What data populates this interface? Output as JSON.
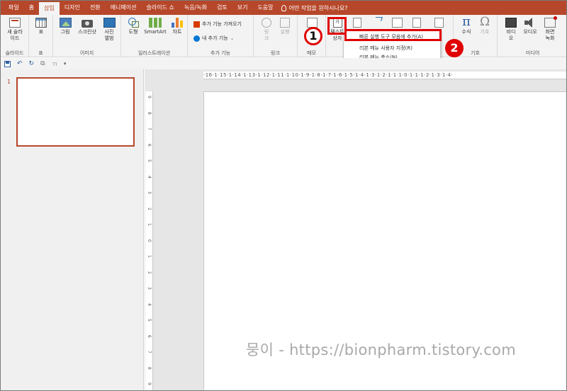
{
  "menu": {
    "tabs": [
      "파일",
      "홈",
      "삽입",
      "디자인",
      "전환",
      "애니메이션",
      "슬라이드 쇼",
      "녹음/녹화",
      "검토",
      "보기",
      "도움말"
    ],
    "active_tab": "삽입",
    "tell_me": "어떤 작업을 원하시나요?"
  },
  "ribbon": {
    "new_slide": "새 슬라이드",
    "new_slide_l1": "새 슬라",
    "new_slide_l2": "이드",
    "grp_slides": "슬라이드",
    "table": "표",
    "grp_table": "표",
    "picture": "그림",
    "screenshot": "스크린샷",
    "album_l1": "사진",
    "album_l2": "앨범",
    "grp_images": "이미지",
    "shapes": "도형",
    "smartart": "SmartArt",
    "chart": "차트",
    "grp_illustrations": "일러스트레이션",
    "get_addins": "추가 기능 가져오기",
    "my_addins": "내 추가 기능",
    "grp_addins": "추가 기능",
    "link_l1": "링",
    "link_l2": "크",
    "action": "실행",
    "grp_links": "링크",
    "memo": "메모",
    "grp_memo": "메모",
    "textbox_l1": "텍스트",
    "textbox_l2": "상자",
    "equation": "수식",
    "symbol": "기호",
    "grp_symbols": "기호",
    "video_l1": "비디",
    "video_l2": "오",
    "audio_l1": "오디오",
    "screenrec_l1": "화면",
    "screenrec_l2": "녹화",
    "grp_media": "미디어"
  },
  "context_menu": {
    "items": [
      "빠른 실행 도구 모음에 추가(A)",
      "리본 메뉴 사용자 지정(R)",
      "리본 메뉴 축소(N)"
    ]
  },
  "callouts": {
    "one": "1",
    "two": "2"
  },
  "qat": {
    "undo_arrow": "↶",
    "redo": "↻",
    "more": "▾"
  },
  "slides_pane": {
    "slide_number": "1"
  },
  "ruler": {
    "horizontal": "·16·1·15·1·14·1·13·1·12·1·11·1·10·1·9·1·8·1·7·1·6·1·5·1·4·1·3·1·2·1·1·1·0·1·1·1·2·1·3·1·4·",
    "vertical": [
      "9",
      "8",
      "7",
      "6",
      "5",
      "4",
      "3",
      "2",
      "1",
      "0",
      "1",
      "2",
      "3",
      "4",
      "5",
      "6",
      "7",
      "8",
      "9"
    ]
  },
  "watermark": "뭉이 - https://bionpharm.tistory.com",
  "colors": {
    "accent": "#b7472a",
    "highlight": "#e00000"
  }
}
